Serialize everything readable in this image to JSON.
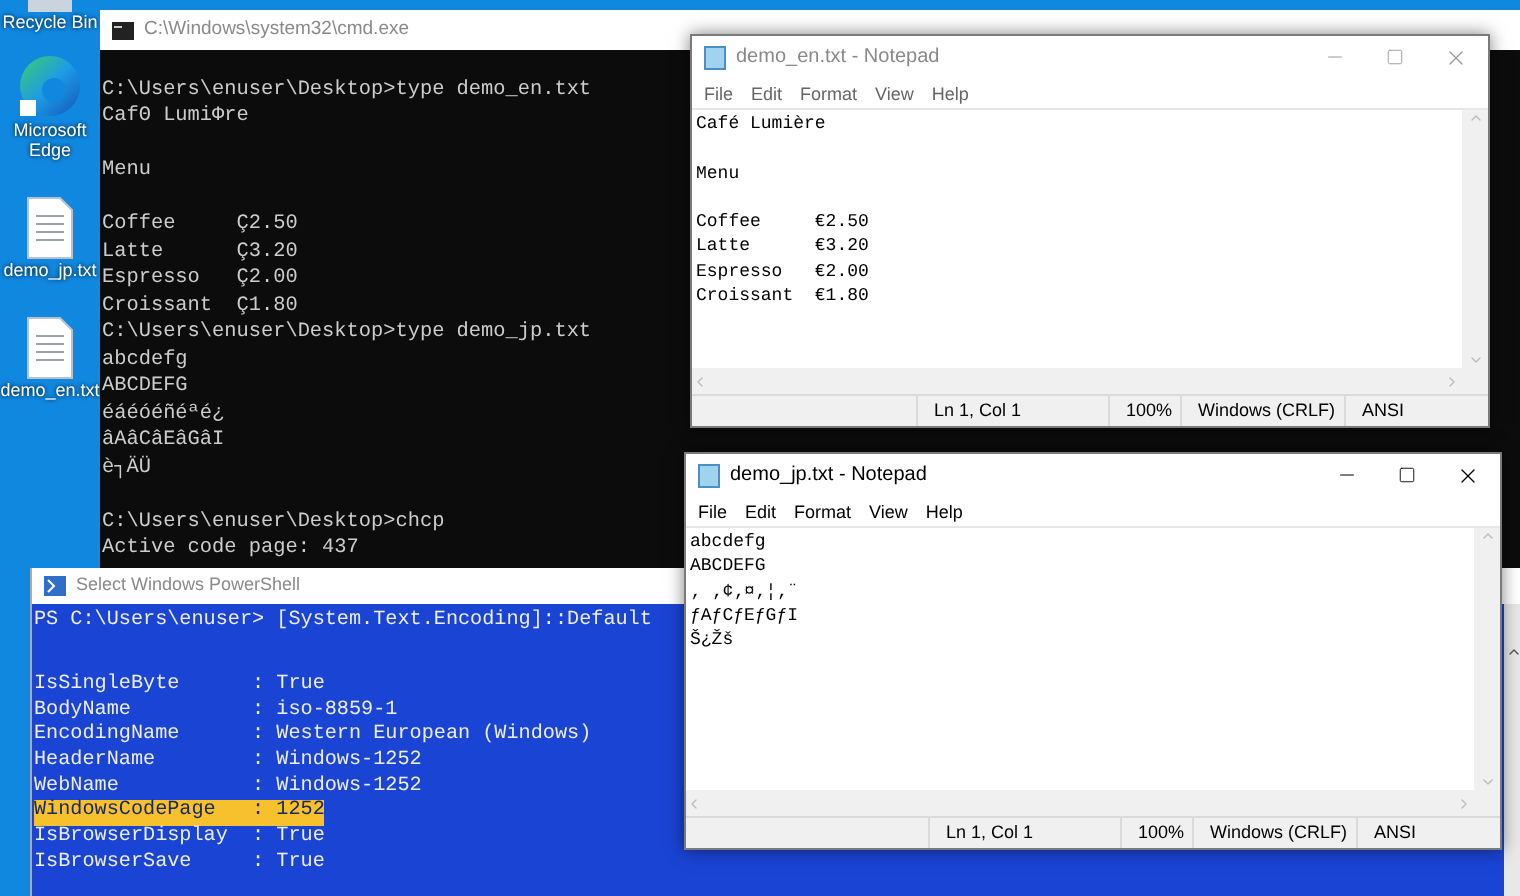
{
  "desktop_icons": [
    {
      "label": "Recycle Bin",
      "kind": "recycle"
    },
    {
      "label": "Microsoft Edge",
      "kind": "edge"
    },
    {
      "label": "demo_jp.txt",
      "kind": "file"
    },
    {
      "label": "demo_en.txt",
      "kind": "file"
    }
  ],
  "cmd_window": {
    "title": "C:\\Windows\\system32\\cmd.exe",
    "paragraphs": [
      [
        "C:\\Users\\enuser\\Desktop>type demo_en.txt",
        "CafΘ LumiΦre"
      ],
      [
        "Menu"
      ],
      [
        "Coffee     Ç2.50",
        "Latte      Ç3.20",
        "Espresso   Ç2.00",
        "Croissant  Ç1.80",
        "C:\\Users\\enuser\\Desktop>type demo_jp.txt",
        "abcdefg",
        "ABCDEFG",
        "éáéóéñéªé¿",
        "âAâCâEâGâI",
        "è┐ÄÜ"
      ],
      [
        "C:\\Users\\enuser\\Desktop>chcp",
        "Active code page: 437"
      ]
    ]
  },
  "notepad_windows": [
    {
      "title": "demo_en.txt - Notepad",
      "active": false,
      "menu": [
        "File",
        "Edit",
        "Format",
        "View",
        "Help"
      ],
      "paragraphs": [
        [
          "Café Lumière"
        ],
        [
          "Menu"
        ],
        [
          "Coffee     €2.50",
          "Latte      €3.20",
          "Espresso   €2.00",
          "Croissant  €1.80"
        ]
      ],
      "status": [
        "Ln 1, Col 1",
        "100%",
        "Windows (CRLF)",
        "ANSI"
      ]
    },
    {
      "title": "demo_jp.txt - Notepad",
      "active": true,
      "menu": [
        "File",
        "Edit",
        "Format",
        "View",
        "Help"
      ],
      "paragraphs": [
        [
          "abcdefg",
          "ABCDEFG",
          "‚ ‚¢‚¤‚¦‚¨",
          "ƒAƒCƒEƒGƒI",
          "Š¿Žš"
        ]
      ],
      "status": [
        "Ln 1, Col 1",
        "100%",
        "Windows (CRLF)",
        "ANSI"
      ]
    }
  ],
  "powershell_window": {
    "title": "Select Windows PowerShell",
    "command": "PS C:\\Users\\enuser> [System.Text.Encoding]::Default",
    "properties": [
      {
        "text": "IsSingleByte      : True",
        "selected": false
      },
      {
        "text": "BodyName          : iso-8859-1",
        "selected": false
      },
      {
        "text": "EncodingName      : Western European (Windows)",
        "selected": false
      },
      {
        "text": "HeaderName        : Windows-1252",
        "selected": false
      },
      {
        "text": "WebName           : Windows-1252",
        "selected": false
      },
      {
        "text": "WindowsCodePage   : 1252",
        "selected": true
      },
      {
        "text": "IsBrowserDisplay  : True",
        "selected": false
      },
      {
        "text": "IsBrowserSave     : True",
        "selected": false
      }
    ]
  }
}
